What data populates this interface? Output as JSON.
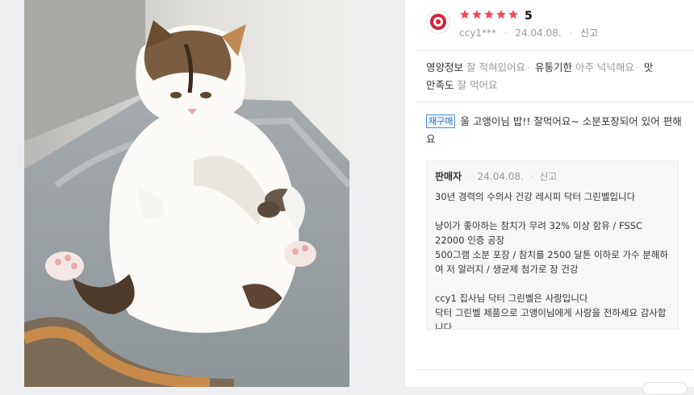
{
  "photo": {
    "description_icon": "cat-photo"
  },
  "review": {
    "rating": "5",
    "star_count": 5,
    "star_color": "#f04a5a",
    "username": "ccy1***",
    "date": "24.04.08.",
    "report_label": "신고",
    "tags": [
      {
        "label": "영양정보",
        "value": "잘 적혀있어요"
      },
      {
        "label": "유통기한",
        "value": "아주 넉넉해요"
      },
      {
        "label": "맛",
        "value": ""
      },
      {
        "label": "만족도",
        "value": "잘 먹어요"
      }
    ],
    "repurchase_badge": "재구매",
    "text": "울 고앵이님 밥!! 잘먹어요~ 소분포장되어 있어 편해요"
  },
  "seller_reply": {
    "name": "판매자",
    "date": "24.04.08.",
    "report_label": "신고",
    "lines": [
      "30년 경력의 수의사 건강 레시피 닥터 그린벨입니다",
      "",
      "냥이가 좋아하는 참치가 무려 32% 이상 함유 / FSSC 22000 인증 공장",
      "500그램 소분 포장 / 참치를 2500 달톤 이하로 가수 분해하여 저 알러지 /  생균제 첨가로 장 건강",
      "",
      "ccy1 집사님   닥터 그린벨은 사랑입니다",
      "닥터 그린벨 제품으로 고앵이님에게 사랑을 전하세요  감사합니다"
    ]
  }
}
